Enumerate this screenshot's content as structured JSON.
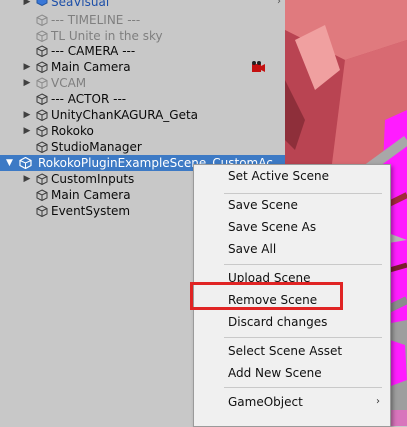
{
  "hierarchy": {
    "items": [
      {
        "label": "SeaVisual",
        "disabled": false,
        "arrow": true
      },
      {
        "label": "--- TIMELINE ---",
        "disabled": true,
        "arrow": false
      },
      {
        "label": "TL Unite in the sky",
        "disabled": true,
        "arrow": false
      },
      {
        "label": "--- CAMERA ---",
        "disabled": false,
        "arrow": false
      },
      {
        "label": "Main Camera",
        "disabled": false,
        "arrow": true
      },
      {
        "label": "VCAM",
        "disabled": true,
        "arrow": true
      },
      {
        "label": "--- ACTOR ---",
        "disabled": false,
        "arrow": false
      },
      {
        "label": "UnityChanKAGURA_Geta",
        "disabled": false,
        "arrow": true
      },
      {
        "label": "Rokoko",
        "disabled": false,
        "arrow": true
      },
      {
        "label": "StudioManager",
        "disabled": false,
        "arrow": false
      }
    ],
    "scene_label": "RokokoPluginExampleScene_CustomAc",
    "children": [
      {
        "label": "CustomInputs",
        "arrow": true
      },
      {
        "label": "Main Camera",
        "arrow": false
      },
      {
        "label": "EventSystem",
        "arrow": false
      }
    ]
  },
  "context_menu": {
    "items": [
      "Set Active Scene",
      "Save Scene",
      "Save Scene As",
      "Save All",
      "Upload Scene",
      "Remove Scene",
      "Discard changes",
      "Select Scene Asset",
      "Add New Scene",
      "GameObject"
    ],
    "highlighted": "Remove Scene"
  },
  "colors": {
    "selection": "#3d7ac5",
    "annotation": "#e02424",
    "scene_pink": "#d25a63",
    "scene_magenta": "#ff1cff"
  }
}
